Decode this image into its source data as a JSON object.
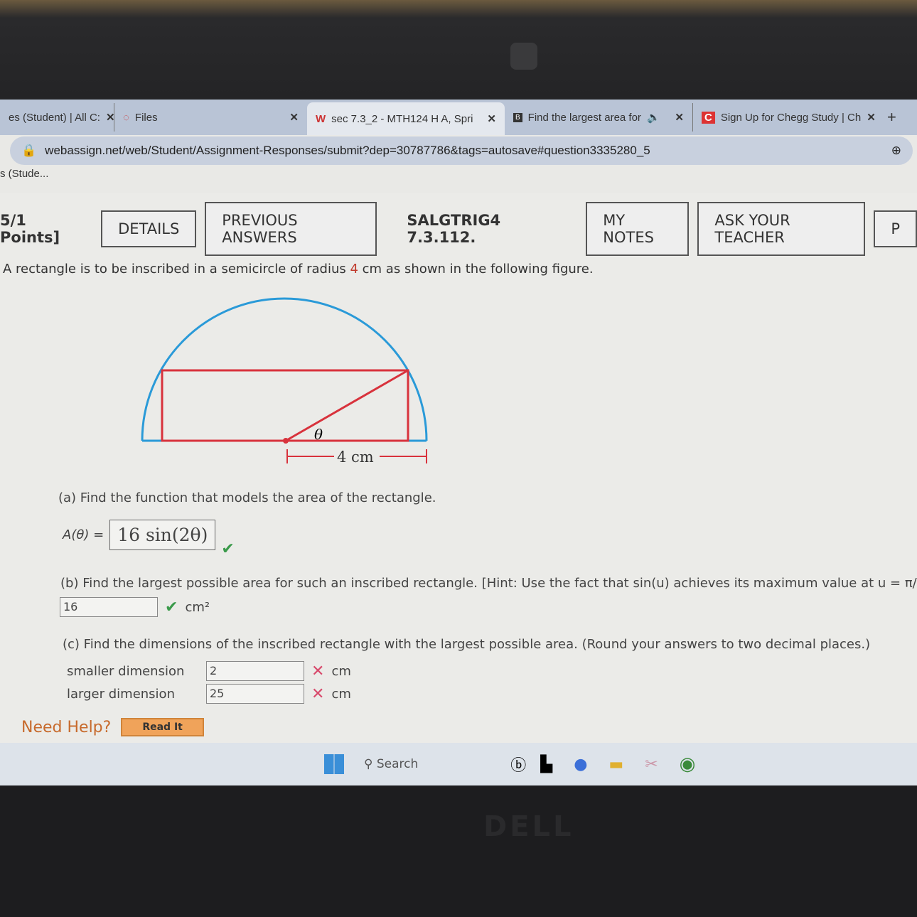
{
  "browser": {
    "tabs": [
      {
        "label": "es (Student) | All C:",
        "close": "✕"
      },
      {
        "label": "Files",
        "close": "✕"
      },
      {
        "label": "sec 7.3_2 - MTH124 H A, Spri",
        "close": "✕",
        "active": true
      },
      {
        "label": "Find the largest area for",
        "close": "✕"
      },
      {
        "label": "Sign Up for Chegg Study | Ch",
        "close": "✕"
      }
    ],
    "new_tab": "+",
    "url": "webassign.net/web/Student/Assignment-Responses/submit?dep=30787786&tags=autosave#question3335280_5",
    "bookmark": "s (Stude..."
  },
  "question": {
    "points": "5/1 Points]",
    "details": "DETAILS",
    "previous_answers": "PREVIOUS ANSWERS",
    "code": "SALGTRIG4 7.3.112.",
    "my_notes": "MY NOTES",
    "ask_teacher": "ASK YOUR TEACHER",
    "more": "P",
    "prompt_before": "A rectangle is to be inscribed in a semicircle of radius ",
    "radius": "4",
    "prompt_after": " cm as shown in the following figure.",
    "figure": {
      "theta": "θ",
      "radius_label": "4 cm",
      "arc_color": "#2a9ad8",
      "rect_color": "#d8323c"
    },
    "part_a": {
      "text": "(a) Find the function that models the area of the rectangle.",
      "label": "A(θ) =",
      "answer": "16 sin(2θ)",
      "status": "correct"
    },
    "part_b": {
      "text": "(b) Find the largest possible area for such an inscribed rectangle. [Hint: Use the fact that sin(u) achieves its maximum value at u = π/",
      "answer": "16",
      "unit": "cm²",
      "status": "correct"
    },
    "part_c": {
      "text": "(c) Find the dimensions of the inscribed rectangle with the largest possible area. (Round your answers to two decimal places.)",
      "rows": [
        {
          "label": "smaller dimension",
          "value": "2",
          "unit": "cm",
          "status": "incorrect"
        },
        {
          "label": "larger dimension",
          "value": "25",
          "unit": "cm",
          "status": "incorrect"
        }
      ]
    },
    "need_help": "Need Help?",
    "read_it": "Read It"
  },
  "taskbar": {
    "search": "Search"
  },
  "laptop_brand": "DELL"
}
